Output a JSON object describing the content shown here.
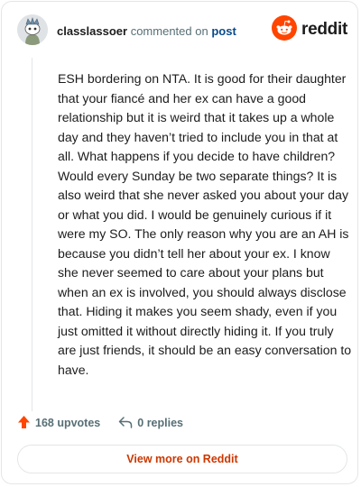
{
  "header": {
    "username": "classlassoer",
    "commented_text": "commented on",
    "post_link": "post",
    "brand_name": "reddit",
    "avatar_icon": "snoo-avatar-icon",
    "brand_icon": "reddit-logo-icon",
    "brand_color": "#ff4500"
  },
  "comment": {
    "body": "ESH bordering on NTA. It is good for their daughter that your fiancé and her ex can have a good relationship but it is weird that it takes up a whole day and they haven’t tried to include you in that at all. What happens if you decide to have children? Would every Sunday be two separate things? It is also weird that she never asked you about your day or what you did. I would be genuinely curious if it were my SO. The only reason why you are an AH is because you didn’t tell her about your ex. I know she never seemed to care about your plans but when an ex is involved, you should always disclose that. Hiding it makes you seem shady, even if you just omitted it without directly hiding it. If you truly are just friends, it should be an easy conversation to have."
  },
  "actions": {
    "upvotes": "168 upvotes",
    "replies": "0 replies",
    "upvote_icon": "upvote-arrow-icon",
    "reply_icon": "reply-arrow-icon"
  },
  "footer": {
    "view_more": "View more on Reddit",
    "accent_color": "#cc3700"
  }
}
